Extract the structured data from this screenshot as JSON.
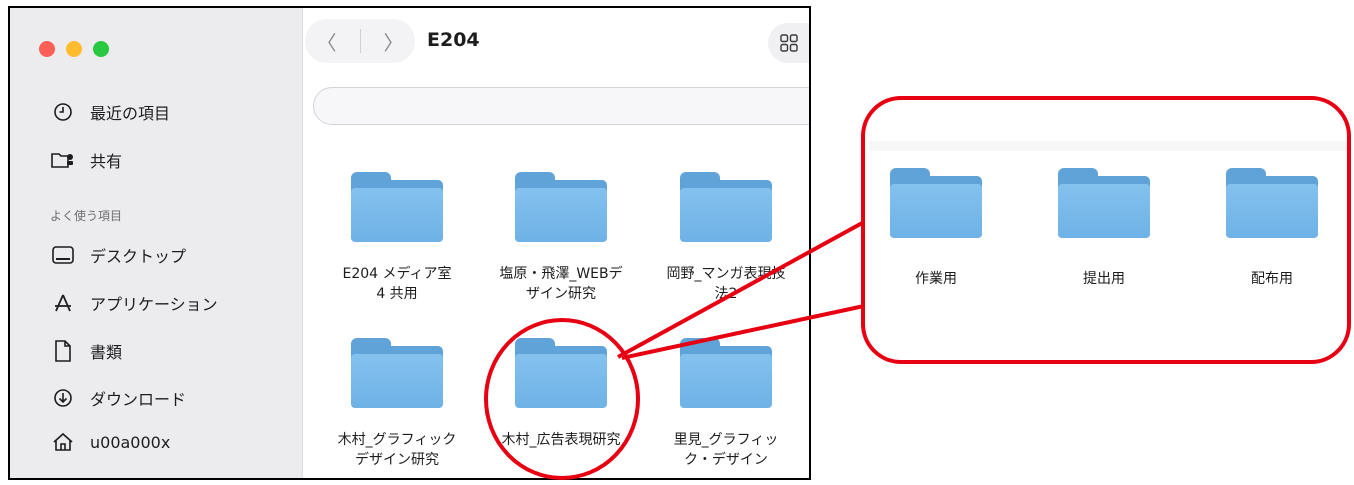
{
  "window": {
    "title": "E204"
  },
  "sidebar": {
    "section_label": "よく使う項目",
    "items": [
      {
        "label": "最近の項目",
        "icon": "clock-icon"
      },
      {
        "label": "共有",
        "icon": "shared-folder-icon"
      },
      {
        "label": "デスクトップ",
        "icon": "desktop-icon"
      },
      {
        "label": "アプリケーション",
        "icon": "applications-icon"
      },
      {
        "label": "書類",
        "icon": "document-icon"
      },
      {
        "label": "ダウンロード",
        "icon": "download-icon"
      },
      {
        "label": "u00a000x",
        "icon": "home-icon"
      }
    ]
  },
  "toolbar": {
    "back": "〈",
    "forward": "〉"
  },
  "folders": [
    {
      "label": "E204 メディア室\n4 共用"
    },
    {
      "label": "塩原・飛澤_WEBデ\nザイン研究"
    },
    {
      "label": "岡野_マンガ表現技\n法2"
    },
    {
      "label": "木村_グラフィック\nデザイン研究"
    },
    {
      "label": "木村_広告表現研究"
    },
    {
      "label": "里見_グラフィッ\nク・デザイン"
    }
  ],
  "callout": {
    "folders": [
      {
        "label": "作業用"
      },
      {
        "label": "提出用"
      },
      {
        "label": "配布用"
      }
    ],
    "accent": "#e60012"
  }
}
